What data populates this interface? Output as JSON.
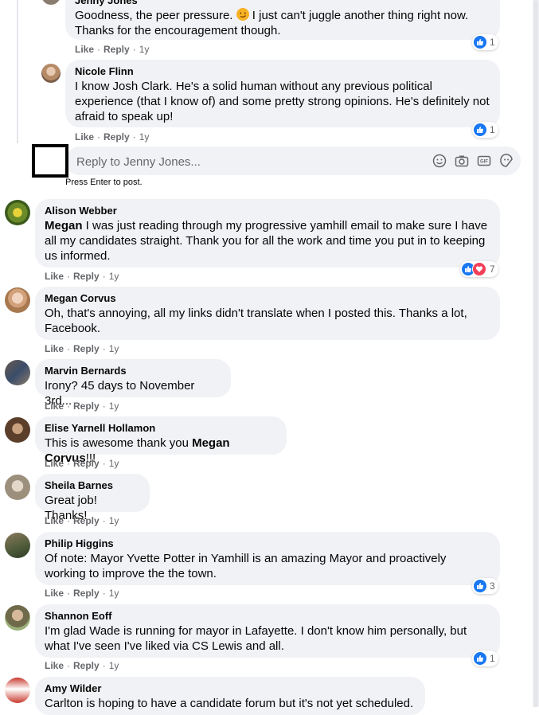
{
  "colors": {
    "like_blue": "#1877f2",
    "love_red": "#f33e58",
    "bubble_bg": "#f0f2f5",
    "meta_gray": "#65676b"
  },
  "actions": {
    "like": "Like",
    "reply": "Reply"
  },
  "replies": [
    {
      "author": "Jenny Jones",
      "text": "Goodness, the peer pressure.",
      "text_after_emoji": " I just can't juggle another thing right now. Thanks for the encouragement though.",
      "emoji": "smirk-emoji",
      "time": "1y",
      "reactions": "1"
    },
    {
      "author": "Nicole Flinn",
      "text": "I know Josh Clark. He's a solid human without any previous political experience (that I know of) and some pretty strong opinions. He's definitely not afraid to speak up!",
      "time": "1y",
      "reactions": "1"
    }
  ],
  "reply_box": {
    "placeholder": "Reply to Jenny Jones...",
    "hint": "Press Enter to post.",
    "icons": [
      "emoji-icon",
      "camera-icon",
      "gif-icon",
      "sticker-icon"
    ]
  },
  "comments": [
    {
      "author": "Alison Webber",
      "mention": "Megan",
      "text": " I was just reading through my progressive yamhill email to make sure I have all my candidates straight. Thank you for all the work and time you put in to keeping us informed.",
      "time": "1y",
      "reactions": "7"
    },
    {
      "author": "Megan Corvus",
      "text": "Oh, that's annoying, all my links didn't translate when I posted this. Thanks a lot, Facebook.",
      "time": "1y"
    },
    {
      "author": "Marvin Bernards",
      "text": "Irony? 45 days to November 3rd...",
      "time": "1y"
    },
    {
      "author": "Elise Yarnell Hollamon",
      "text": "This is awesome thank you ",
      "mention": "Megan Corvus",
      "text_after": "!!!",
      "time": "1y"
    },
    {
      "author": "Sheila Barnes",
      "text": "Great job! Thanks!",
      "time": "1y"
    },
    {
      "author": "Philip Higgins",
      "text": "Of note: Mayor Yvette Potter in Yamhill is an amazing Mayor and proactively working to improve the the town.",
      "time": "1y",
      "reactions": "3"
    },
    {
      "author": "Shannon Eoff",
      "text": "I'm glad Wade is running for mayor in Lafayette. I don't know him personally, but what I've seen I've liked via CS Lewis and all.",
      "time": "1y",
      "reactions": "1"
    },
    {
      "author": "Amy Wilder",
      "text": "Carlton is hoping to have a candidate forum but it's not yet scheduled."
    }
  ]
}
